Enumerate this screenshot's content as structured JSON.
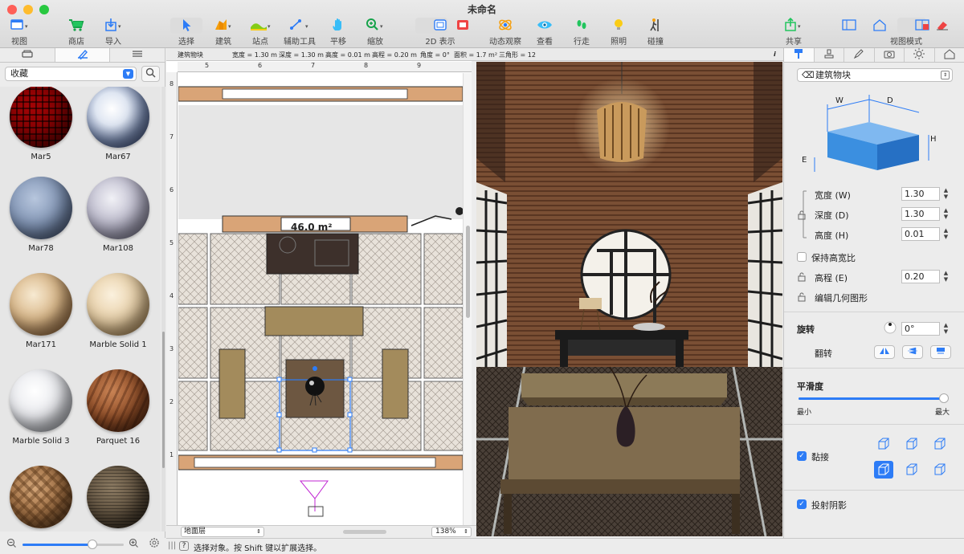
{
  "window": {
    "title": "未命名"
  },
  "toolbar": {
    "view": "视图",
    "store": "商店",
    "import": "导入",
    "select": "选择",
    "build": "建筑",
    "station": "站点",
    "aux": "辅助工具",
    "pan": "平移",
    "zoom": "缩放",
    "display2d": "2D 表示",
    "orbit": "动态观察",
    "look": "查看",
    "walk": "行走",
    "light": "照明",
    "collide": "碰撞",
    "share": "共享",
    "viewmode": "视图模式"
  },
  "library": {
    "collection": "收藏",
    "materials": [
      {
        "name": "Mar5"
      },
      {
        "name": "Mar67"
      },
      {
        "name": "Mar78"
      },
      {
        "name": "Mar108"
      },
      {
        "name": "Mar171"
      },
      {
        "name": "Marble Solid 1"
      },
      {
        "name": "Marble Solid 3"
      },
      {
        "name": "Parquet 16"
      },
      {
        "name": ""
      },
      {
        "name": ""
      }
    ]
  },
  "infobar": {
    "object": "建筑物块",
    "width": "宽度 = 1.30 m",
    "depth": "深度 = 1.30 m",
    "height": "高度 = 0.01 m",
    "elevation": "高程 = 0.20 m",
    "angle": "角度 = 0°",
    "area": "面积 = 1.7 m²",
    "triangles": "三角形 = 12",
    "info_icon": "i"
  },
  "plan": {
    "area_label": "46.0 m²",
    "ruler_h": [
      "5",
      "6",
      "7",
      "8",
      "9"
    ],
    "ruler_v": [
      "8",
      "7",
      "6",
      "5",
      "4",
      "3",
      "2",
      "1"
    ],
    "level": "地面层",
    "zoom": "138%"
  },
  "inspector": {
    "object_type": "建筑物块",
    "dims": {
      "w": "W",
      "d": "D",
      "h": "H",
      "e": "E"
    },
    "width_label": "宽度 (W)",
    "width_value": "1.30",
    "depth_label": "深度 (D)",
    "depth_value": "1.30",
    "height_label": "高度 (H)",
    "height_value": "0.01",
    "keep_ratio": "保持高宽比",
    "elevation_label": "高程 (E)",
    "elevation_value": "0.20",
    "edit_geometry": "编辑几何图形",
    "rotation_title": "旋转",
    "rotation_value": "0°",
    "flip_label": "翻转",
    "smooth_title": "平滑度",
    "smooth_min": "最小",
    "smooth_max": "最大",
    "smooth_value": 1.0,
    "snap_label": "黏接",
    "snap_checked": true,
    "shadow_label": "投射阴影",
    "shadow_checked": true
  },
  "status": {
    "text": "选择对象。按 Shift 键以扩展选择。"
  }
}
